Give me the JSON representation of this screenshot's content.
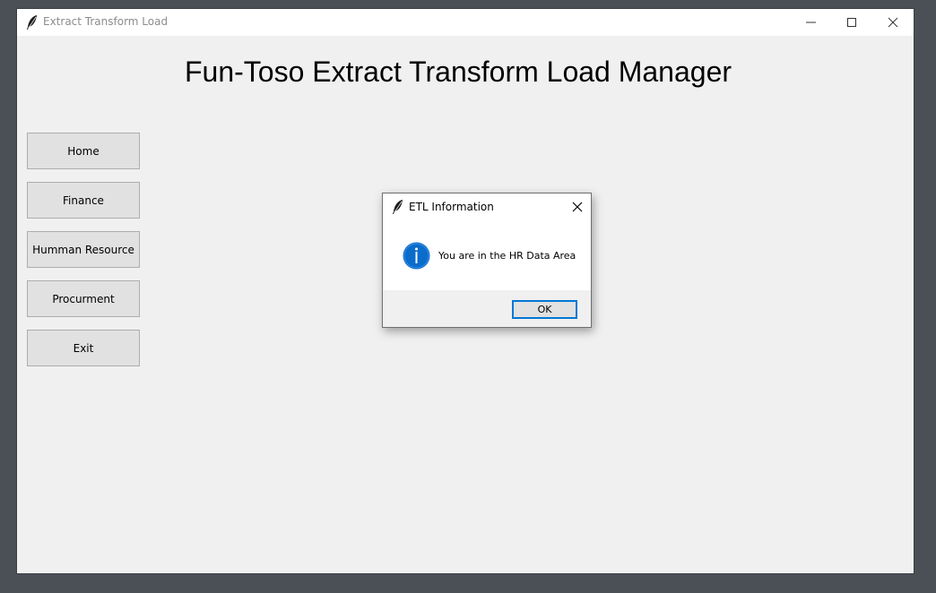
{
  "window": {
    "title": "Extract Transform Load",
    "icon": "feather-icon"
  },
  "main": {
    "heading": "Fun-Toso Extract Transform Load Manager"
  },
  "nav": {
    "items": [
      {
        "label": "Home"
      },
      {
        "label": "Finance"
      },
      {
        "label": "Humman Resource"
      },
      {
        "label": "Procurment"
      },
      {
        "label": "Exit"
      }
    ]
  },
  "dialog": {
    "title": "ETL Information",
    "icon": "info-icon",
    "message": "You are in the HR Data Area",
    "ok_label": "OK"
  },
  "colors": {
    "desktop": "#4a5056",
    "window_bg": "#f0f0f0",
    "button_bg": "#e1e1e1",
    "accent": "#0078d7"
  }
}
